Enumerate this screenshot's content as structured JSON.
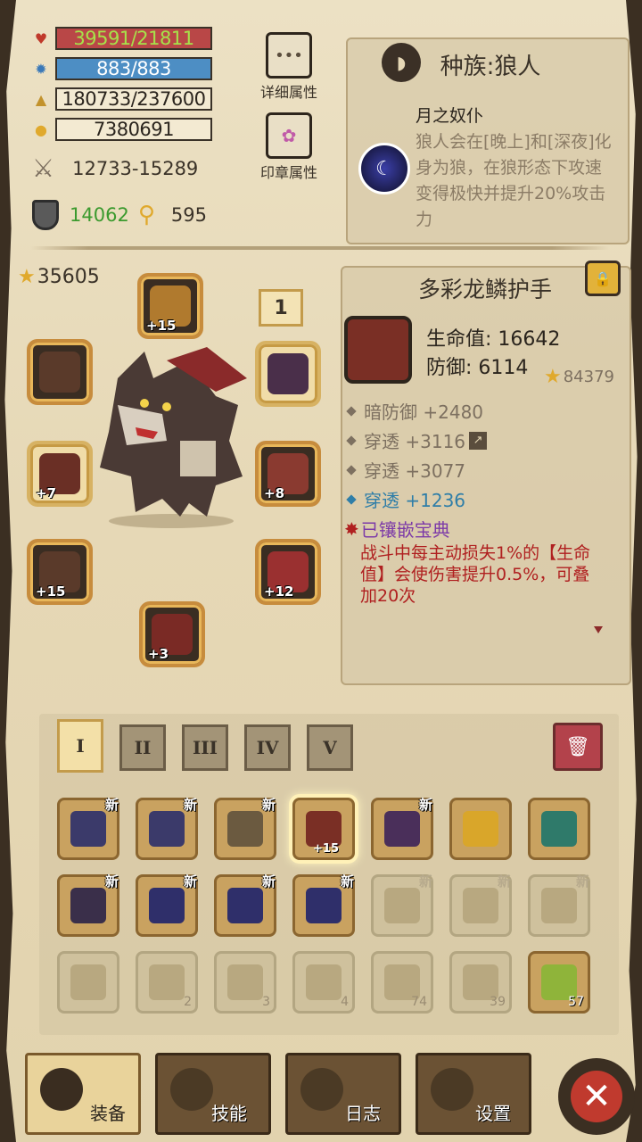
{
  "stats": {
    "hp": "39591/21811",
    "mp": "883/883",
    "xp": "180733/237600",
    "gold": "7380691",
    "attack": "12733-15289",
    "defense": "14062",
    "magic": "595"
  },
  "side_buttons": {
    "detail": "详细属性",
    "seal": "印章属性"
  },
  "race": {
    "title": "种族:狼人",
    "trait_name": "月之奴仆",
    "trait_desc": "狼人会在[晚上]和[深夜]化身为狼，在狼形态下攻速变得极快并提升20%攻击力"
  },
  "character": {
    "power_score": "35605",
    "page": "1",
    "slots": [
      {
        "name": "helmet",
        "level": "+15"
      },
      {
        "name": "necklace",
        "level": ""
      },
      {
        "name": "bat-charm",
        "level": ""
      },
      {
        "name": "gauntlet",
        "level": "+7"
      },
      {
        "name": "armor",
        "level": "+8"
      },
      {
        "name": "bracer",
        "level": "+15"
      },
      {
        "name": "pants",
        "level": "+12"
      },
      {
        "name": "boots",
        "level": "+3"
      }
    ]
  },
  "item": {
    "name": "多彩龙鳞护手",
    "hp_label": "生命值: 16642",
    "def_label": "防御: 6114",
    "score": "84379",
    "attrs": [
      {
        "text": "暗防御 +2480",
        "style": "normal"
      },
      {
        "text": "穿透 +3116",
        "style": "normal"
      },
      {
        "text": "穿透 +3077",
        "style": "normal"
      },
      {
        "text": "穿透 +1236",
        "style": "blue"
      },
      {
        "text": "已镶嵌宝典",
        "style": "purple"
      }
    ],
    "effect": "战斗中每主动损失1%的【生命值】会使伤害提升0.5%，可叠加20次"
  },
  "inventory": {
    "tabs": [
      "I",
      "II",
      "III",
      "IV",
      "V"
    ],
    "new_badge": "新",
    "rows": [
      [
        {
          "new": true,
          "dim": false,
          "count": "",
          "level": "",
          "color": "#3b3a6a"
        },
        {
          "new": true,
          "dim": false,
          "count": "",
          "level": "",
          "color": "#3b3a6a"
        },
        {
          "new": true,
          "dim": false,
          "count": "",
          "level": "",
          "color": "#6b5a40"
        },
        {
          "new": false,
          "dim": false,
          "count": "",
          "level": "+15",
          "color": "#7a2f25",
          "selected": true
        },
        {
          "new": true,
          "dim": false,
          "count": "",
          "level": "",
          "color": "#4a2f5a"
        },
        {
          "new": false,
          "dim": false,
          "count": "",
          "level": "",
          "color": "#d9a62a"
        },
        {
          "new": false,
          "dim": false,
          "count": "",
          "level": "",
          "color": "#2f7a6a"
        }
      ],
      [
        {
          "new": true,
          "dim": false,
          "count": "",
          "level": "",
          "color": "#3a2f4a"
        },
        {
          "new": true,
          "dim": false,
          "count": "",
          "level": "",
          "color": "#2f2f6a"
        },
        {
          "new": true,
          "dim": false,
          "count": "",
          "level": "",
          "color": "#2f2f6a"
        },
        {
          "new": true,
          "dim": false,
          "count": "",
          "level": "",
          "color": "#2f2f6a"
        },
        {
          "new": true,
          "dim": true,
          "count": "",
          "level": "",
          "color": "#b8a880"
        },
        {
          "new": true,
          "dim": true,
          "count": "",
          "level": "",
          "color": "#b8a880"
        },
        {
          "new": true,
          "dim": true,
          "count": "",
          "level": "",
          "color": "#b8a880"
        }
      ],
      [
        {
          "new": false,
          "dim": true,
          "count": "",
          "level": "",
          "color": "#b8a880"
        },
        {
          "new": false,
          "dim": true,
          "count": "2",
          "level": "",
          "color": "#b8a880"
        },
        {
          "new": false,
          "dim": true,
          "count": "3",
          "level": "",
          "color": "#b8a880"
        },
        {
          "new": false,
          "dim": true,
          "count": "4",
          "level": "",
          "color": "#b8a880"
        },
        {
          "new": false,
          "dim": true,
          "count": "74",
          "level": "",
          "color": "#b8a880"
        },
        {
          "new": false,
          "dim": true,
          "count": "39",
          "level": "",
          "color": "#b8a880"
        },
        {
          "new": false,
          "dim": false,
          "count": "57",
          "level": "",
          "color": "#8fb43a"
        }
      ]
    ]
  },
  "nav": {
    "equip": "装备",
    "skill": "技能",
    "log": "日志",
    "settings": "设置"
  },
  "colors": {
    "hp_bar": "#b94747",
    "mp_bar": "#4d8ec4",
    "effect_text": "#b02020",
    "penetration_blue": "#2f7ea8"
  }
}
